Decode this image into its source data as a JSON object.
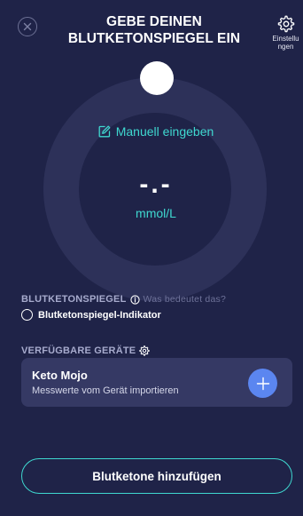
{
  "header": {
    "title": "GEBE DEINEN BLUTKETONSPIEGEL EIN",
    "settings_label": "Einstellu\nngen",
    "close_icon": "close-icon",
    "settings_icon": "gear-icon"
  },
  "dial": {
    "manual_label": "Manuell eingeben",
    "manual_icon": "edit-icon",
    "reading": "-.-",
    "unit": "mmol/L"
  },
  "ketone_section": {
    "label": "BLUTKETONSPIEGEL",
    "info_icon": "info-icon",
    "help_link": "Was bedeutet das?",
    "indicator_label": "Blutketonspiegel-Indikator"
  },
  "devices_section": {
    "label": "VERFÜGBARE GERÄTE",
    "settings_icon": "gear-icon",
    "devices": [
      {
        "name": "Keto Mojo",
        "subtitle": "Messwerte vom Gerät importieren",
        "action_icon": "plus-icon"
      }
    ]
  },
  "footer": {
    "add_button_label": "Blutketone hinzufügen"
  },
  "colors": {
    "background": "#1f2348",
    "accent_teal": "#3fd8d0",
    "button_blue": "#5b86f0",
    "card": "#353964",
    "dial_ring": "#2d3159"
  }
}
